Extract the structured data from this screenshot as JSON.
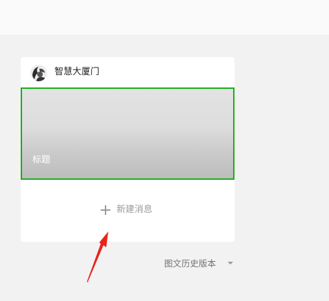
{
  "account": {
    "name": "智慧大厦门",
    "avatar_icon": "avatar-image"
  },
  "article": {
    "cover_title": "标题",
    "selected_border_color": "#1aad19"
  },
  "new_message": {
    "icon": "plus-icon",
    "label": "新建消息"
  },
  "history": {
    "label": "图文历史版本",
    "icon": "caret-down-icon"
  },
  "annotation": {
    "icon": "red-arrow-icon",
    "color": "#e8231c"
  }
}
